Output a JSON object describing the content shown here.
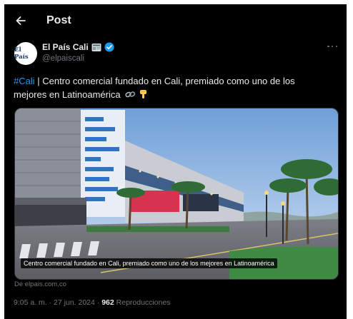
{
  "header": {
    "title": "Post",
    "back_icon": "arrow-left-icon"
  },
  "author": {
    "name": "El País Cali",
    "handle": "@elpaiscali",
    "avatar_text": "El País",
    "badges": [
      "newspaper-emoji-icon",
      "verified-badge-icon"
    ],
    "verified_color": "#1d9bf0"
  },
  "post": {
    "hashtag": "#Cali",
    "text": " | Centro comercial fundado en Cali, premiado como uno de los mejores en Latinoamérica",
    "emojis": [
      "link-emoji-icon",
      "pointing-down-emoji-icon"
    ]
  },
  "card": {
    "caption": "Centro comercial fundado en Cali, premiado como uno de los mejores en Latinoamérica",
    "source": "De elpais.com.co"
  },
  "meta": {
    "time": "9:05 a. m.",
    "separator": " · ",
    "date": "27 jun. 2024",
    "views": "962",
    "views_label": " Reproducciones"
  },
  "colors": {
    "background": "#000000",
    "text": "#e7e9ea",
    "muted": "#71767b",
    "accent": "#1d9bf0"
  }
}
